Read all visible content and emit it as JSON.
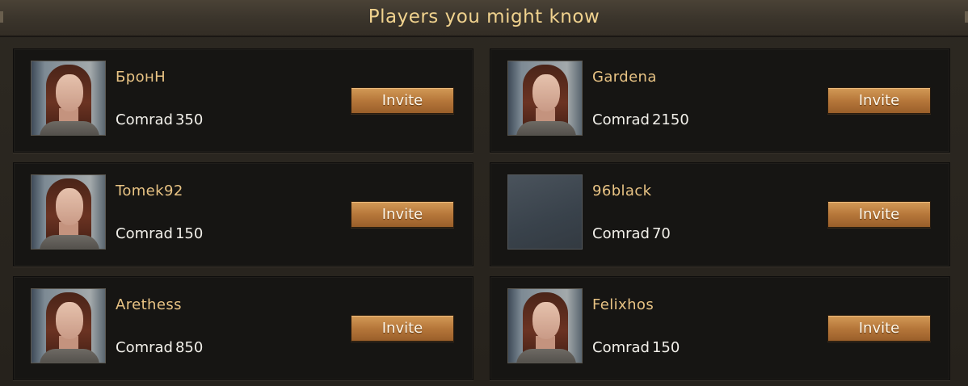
{
  "header": {
    "title": "Players you might know"
  },
  "players": [
    {
      "name": "БронН",
      "level_label": "Comrad",
      "level": "350",
      "avatar": "portrait",
      "invite_label": "Invite"
    },
    {
      "name": "Gardena",
      "level_label": "Comrad",
      "level": "2150",
      "avatar": "portrait",
      "invite_label": "Invite"
    },
    {
      "name": "Tomek92",
      "level_label": "Comrad",
      "level": "150",
      "avatar": "portrait",
      "invite_label": "Invite"
    },
    {
      "name": "96black",
      "level_label": "Comrad",
      "level": "70",
      "avatar": "blank",
      "invite_label": "Invite"
    },
    {
      "name": "Arethess",
      "level_label": "Comrad",
      "level": "850",
      "avatar": "portrait",
      "invite_label": "Invite"
    },
    {
      "name": "Felixhos",
      "level_label": "Comrad",
      "level": "150",
      "avatar": "portrait",
      "invite_label": "Invite"
    }
  ],
  "colors": {
    "title": "#f0d28e",
    "name": "#e8c384",
    "button": "#b6773a"
  }
}
